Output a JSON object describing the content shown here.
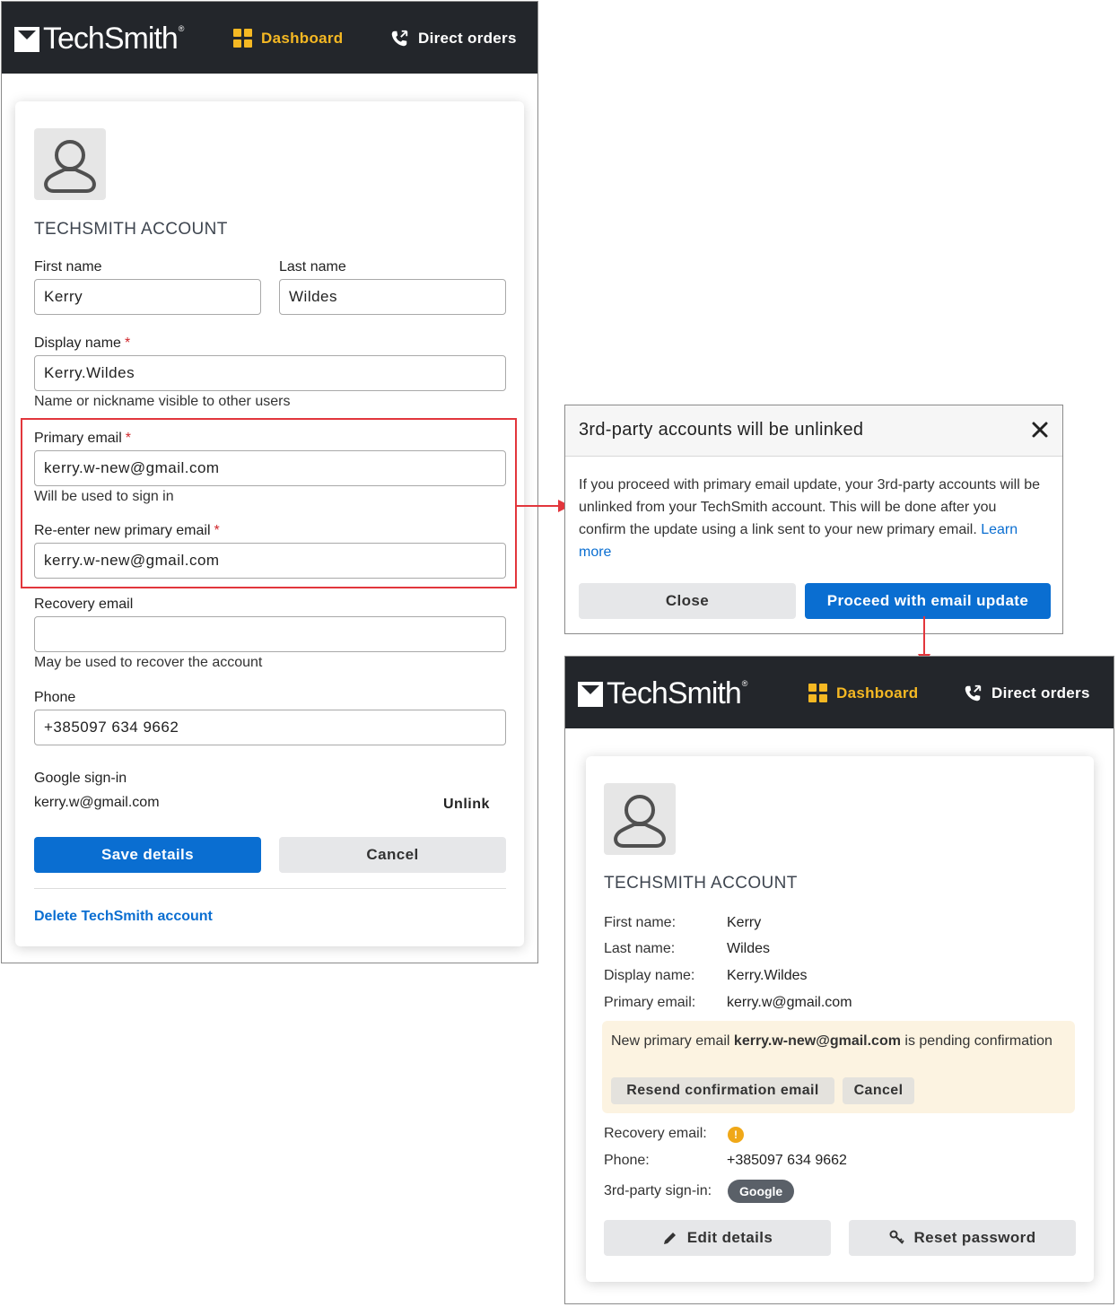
{
  "brand": {
    "name": "TechSmith",
    "reg": "®"
  },
  "nav": {
    "dashboard": "Dashboard",
    "direct_orders": "Direct orders"
  },
  "edit_form": {
    "title": "TECHSMITH ACCOUNT",
    "first_name_label": "First name",
    "first_name_value": "Kerry",
    "last_name_label": "Last name",
    "last_name_value": "Wildes",
    "display_name_label": "Display name",
    "display_name_value": "Kerry.Wildes",
    "display_name_help": "Name or nickname visible to other users",
    "primary_email_label": "Primary email",
    "primary_email_value": "kerry.w-new@gmail.com",
    "primary_email_help": "Will be used to sign in",
    "reenter_email_label": "Re-enter new primary email",
    "reenter_email_value": "kerry.w-new@gmail.com",
    "recovery_email_label": "Recovery email",
    "recovery_email_value": "",
    "recovery_email_help": "May be used to recover the account",
    "phone_label": "Phone",
    "phone_value": "+385097 634 9662",
    "google_label": "Google sign-in",
    "google_email": "kerry.w@gmail.com",
    "unlink": "Unlink",
    "save": "Save details",
    "cancel": "Cancel",
    "delete": "Delete TechSmith account",
    "required_mark": "*"
  },
  "dialog": {
    "title": "3rd-party accounts will be unlinked",
    "body": "If you proceed with primary email update, your 3rd-party accounts will be unlinked from your TechSmith account. This will be done after you confirm the update using a link sent to your new primary email.",
    "learn_more": "Learn more",
    "close": "Close",
    "proceed": "Proceed with email update"
  },
  "summary": {
    "title": "TECHSMITH ACCOUNT",
    "first_name_label": "First name:",
    "first_name": "Kerry",
    "last_name_label": "Last name:",
    "last_name": "Wildes",
    "display_name_label": "Display name:",
    "display_name": "Kerry.Wildes",
    "primary_email_label": "Primary email:",
    "primary_email": "kerry.w@gmail.com",
    "pending_prefix": "New primary email",
    "pending_email": "kerry.w-new@gmail.com",
    "pending_suffix": "is pending confirmation",
    "resend": "Resend confirmation email",
    "cancel": "Cancel",
    "recovery_label": "Recovery email:",
    "recovery_warning": "!",
    "phone_label": "Phone:",
    "phone": "+385097 634 9662",
    "third_party_label": "3rd-party sign-in:",
    "third_party_badge": "Google",
    "edit": "Edit details",
    "reset": "Reset password"
  },
  "colors": {
    "accent": "#0a6ed1",
    "nav_highlight": "#f5b823",
    "header_bg": "#23262b",
    "callout_red": "#e2363c",
    "pending_bg": "#fcf3e1"
  }
}
